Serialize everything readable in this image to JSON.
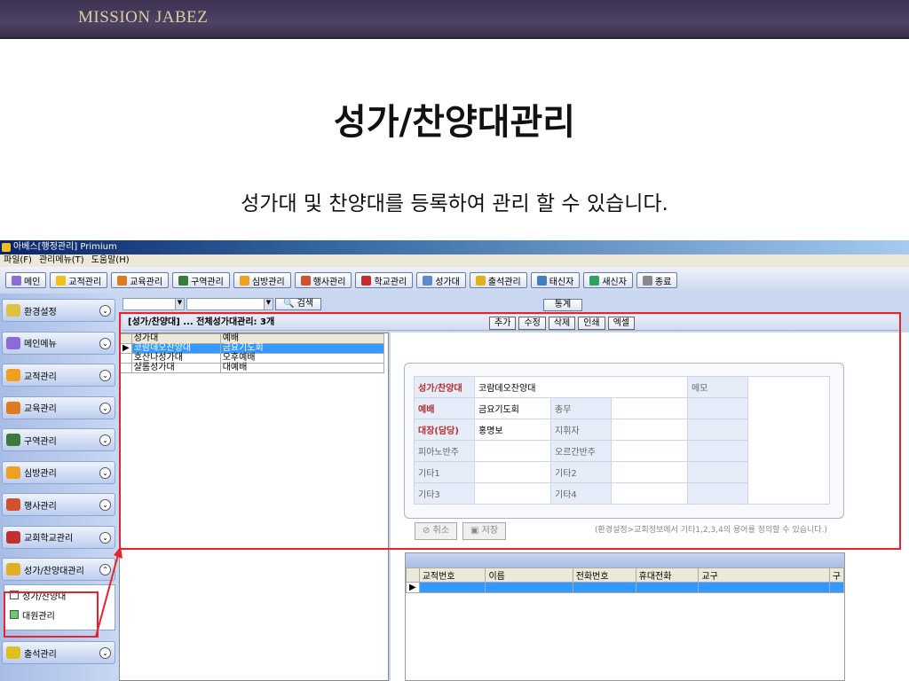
{
  "banner": {
    "logo": "MISSION JABEZ"
  },
  "slide": {
    "title": "성가/찬양대관리",
    "subtitle": "성가대 및 찬양대를 등록하여 관리 할 수 있습니다."
  },
  "app": {
    "title": "아베스[행정관리]  Primium",
    "menu": [
      "파일(F)",
      "관리메뉴(T)",
      "도움말(H)"
    ],
    "toolbar": [
      {
        "label": "메인",
        "color": "#8b6bd6"
      },
      {
        "label": "교적관리",
        "color": "#f0c020"
      },
      {
        "label": "교육관리",
        "color": "#e07a20"
      },
      {
        "label": "구역관리",
        "color": "#3a7a3a"
      },
      {
        "label": "심방관리",
        "color": "#f0a020"
      },
      {
        "label": "행사관리",
        "color": "#d05030"
      },
      {
        "label": "학교관리",
        "color": "#c03030"
      },
      {
        "label": "성가대",
        "color": "#5a8ad0"
      },
      {
        "label": "출석관리",
        "color": "#e0b020"
      },
      {
        "label": "태신자",
        "color": "#4080c0"
      },
      {
        "label": "새신자",
        "color": "#30a060"
      },
      {
        "label": "종료",
        "color": "#888888"
      }
    ],
    "sidebar": [
      {
        "label": "환경설정",
        "color": "#e0c040"
      },
      {
        "label": "메인메뉴",
        "color": "#8b6bd6"
      },
      {
        "label": "교적관리",
        "color": "#f0a020"
      },
      {
        "label": "교육관리",
        "color": "#e07a20"
      },
      {
        "label": "구역관리",
        "color": "#3a7a3a"
      },
      {
        "label": "심방관리",
        "color": "#f0a020"
      },
      {
        "label": "행사관리",
        "color": "#d05030"
      },
      {
        "label": "교회학교관리",
        "color": "#c03030"
      },
      {
        "label": "성가/찬양대관리",
        "color": "#e0b020"
      },
      {
        "label": "출석관리",
        "color": "#e0c020"
      }
    ],
    "subitems": [
      "성가/찬양대",
      "대원관리"
    ],
    "search": {
      "button": "검색",
      "stats": "통계"
    },
    "panel": {
      "header": "[성가/찬양대] ... 전체성가대관리: 3개",
      "actions": [
        "추가",
        "수정",
        "삭제",
        "인쇄",
        "엑셀"
      ]
    },
    "grid": {
      "columns": [
        "성가대",
        "예배"
      ],
      "rows": [
        [
          "코람데오찬양대",
          "금요기도회"
        ],
        [
          "호산나성가대",
          "오후예배"
        ],
        [
          "샬롬성가대",
          "대예배"
        ]
      ]
    },
    "form": {
      "rows": [
        [
          "성가/찬양대",
          "코람데오찬양대"
        ],
        [
          "예배",
          "금요기도회",
          "총무",
          ""
        ],
        [
          "대장(담당)",
          "홍명보",
          "지휘자",
          ""
        ],
        [
          "피아노반주",
          "",
          "오르간반주",
          ""
        ],
        [
          "기타1",
          "",
          "기타2",
          ""
        ],
        [
          "기타3",
          "",
          "기타4",
          ""
        ]
      ],
      "memo_label": "메모",
      "cancel": "취소",
      "save": "저장",
      "note": "(환경설정>교회정보에서 기타1,2,3,4의 용어를 정의할 수 있습니다.)"
    },
    "grid2": {
      "columns": [
        "교적번호",
        "이름",
        "전화번호",
        "휴대전화",
        "교구",
        "구"
      ]
    }
  }
}
